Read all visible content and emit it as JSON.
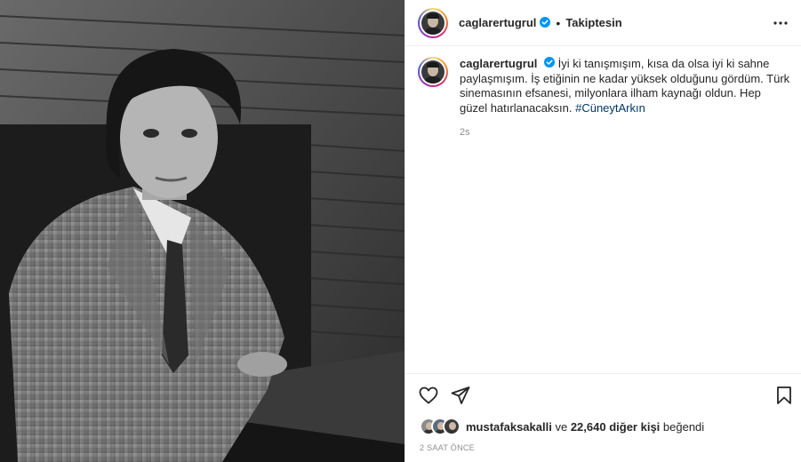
{
  "post": {
    "photo_description_icon": "portrait-photo",
    "author": {
      "username": "caglarertugrul",
      "verified": true,
      "follow_status": "Takiptesin"
    },
    "caption": {
      "username": "caglarertugrul",
      "text": "İyi ki tanışmışım, kısa da olsa iyi ki sahne paylaşmışım. İş etiğinin ne kadar yüksek olduğunu gördüm. Türk sinemasının efsanesi, milyonlara ilham kaynağı oldun. Hep güzel hatırlanacaksın.",
      "hashtag": "#CüneytArkın",
      "time_ago": "2s"
    },
    "actions": {
      "like_icon": "heart-icon",
      "share_icon": "send-icon",
      "save_icon": "bookmark-icon",
      "more_icon": "more-horizontal-icon"
    },
    "likes": {
      "first_liker": "mustafaksakalli",
      "connector": "ve",
      "others_count": "22,640 diğer kişi",
      "suffix": "beğendi"
    },
    "post_date": "2 SAAT ÖNCE"
  },
  "colors": {
    "text": "#262626",
    "muted": "#8e8e8e",
    "link": "#00376b",
    "verified": "#0095f6",
    "divider": "#efefef"
  }
}
